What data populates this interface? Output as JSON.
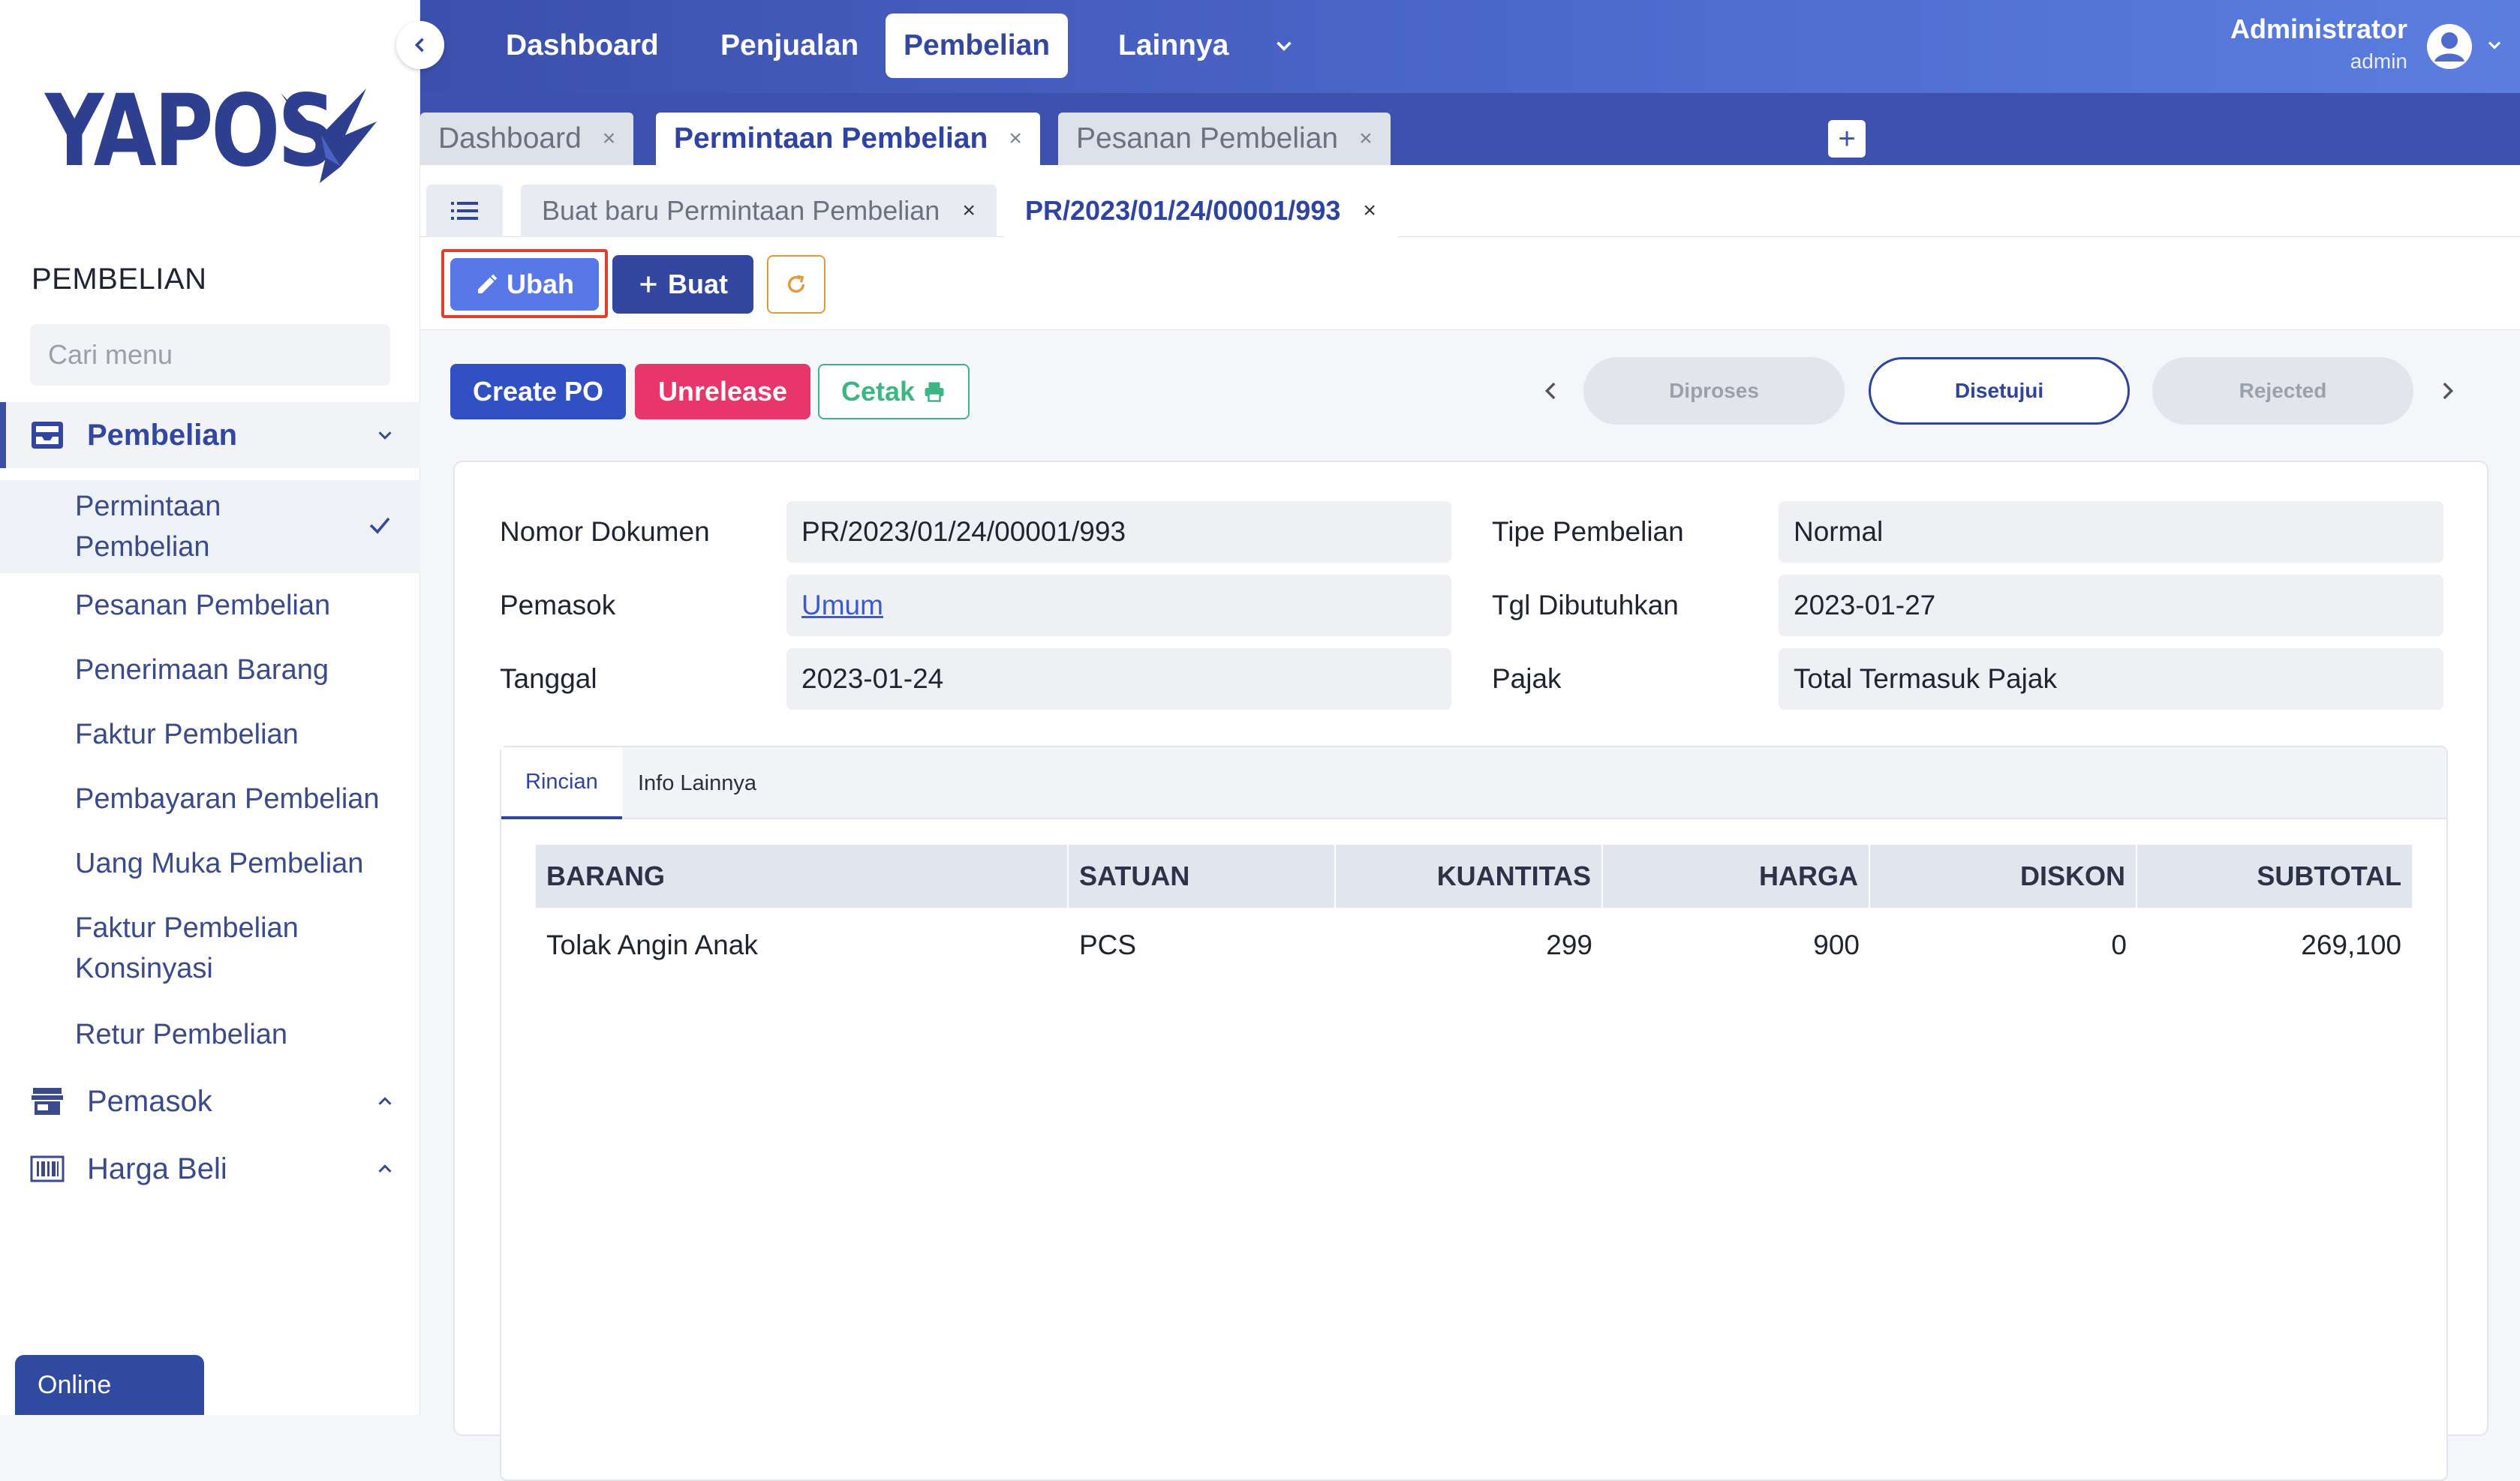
{
  "brand": {
    "logo_text": "YAPOS"
  },
  "sidebar": {
    "section_title": "PEMBELIAN",
    "search_placeholder": "Cari menu",
    "group_pembelian": "Pembelian",
    "items": [
      {
        "label": "Permintaan\nPembelian",
        "active": true
      },
      {
        "label": "Pesanan Pembelian"
      },
      {
        "label": "Penerimaan Barang"
      },
      {
        "label": "Faktur Pembelian"
      },
      {
        "label": "Pembayaran Pembelian"
      },
      {
        "label": "Uang Muka Pembelian"
      },
      {
        "label": "Faktur Pembelian\nKonsinyasi"
      },
      {
        "label": "Retur Pembelian"
      }
    ],
    "group_pemasok": "Pemasok",
    "group_harga_beli": "Harga Beli",
    "online_label": "Online"
  },
  "topnav": {
    "items": [
      "Dashboard",
      "Penjualan",
      "Pembelian",
      "Lainnya"
    ],
    "active": "Pembelian"
  },
  "user": {
    "name": "Administrator",
    "role": "admin"
  },
  "tabs_main": [
    {
      "label": "Dashboard",
      "close": "×"
    },
    {
      "label": "Permintaan Pembelian",
      "close": "×"
    },
    {
      "label": "Pesanan Pembelian",
      "close": "×"
    }
  ],
  "tab_add": "+",
  "tabs_sub": [
    {
      "label": "Buat baru Permintaan Pembelian",
      "close": "×"
    },
    {
      "label": "PR/2023/01/24/00001/993",
      "close": "×"
    }
  ],
  "toolbar": {
    "edit_label": "Ubah",
    "create_label": "Buat"
  },
  "actions": {
    "create_po": "Create PO",
    "unrelease": "Unrelease",
    "print": "Cetak"
  },
  "status": {
    "steps": [
      "Diproses",
      "Disetujui",
      "Rejected"
    ],
    "current": "Disetujui"
  },
  "form": {
    "doc_number_label": "Nomor Dokumen",
    "doc_number": "PR/2023/01/24/00001/993",
    "supplier_label": "Pemasok",
    "supplier": "Umum",
    "date_label": "Tanggal",
    "date": "2023-01-24",
    "purchase_type_label": "Tipe Pembelian",
    "purchase_type": "Normal",
    "needed_date_label": "Tgl Dibutuhkan",
    "needed_date": "2023-01-27",
    "tax_label": "Pajak",
    "tax": "Total Termasuk Pajak"
  },
  "detail_tabs": [
    "Rincian",
    "Info Lainnya"
  ],
  "grid": {
    "columns": [
      "BARANG",
      "SATUAN",
      "KUANTITAS",
      "HARGA",
      "DISKON",
      "SUBTOTAL"
    ],
    "rows": [
      [
        "Tolak Angin Anak",
        "PCS",
        "299",
        "900",
        "0",
        "269,100"
      ]
    ]
  },
  "colors": {
    "primary": "#3447a0",
    "accent": "#5878e8",
    "danger": "#e8356a",
    "success": "#3cb784",
    "highlight_border": "#e0402a"
  }
}
